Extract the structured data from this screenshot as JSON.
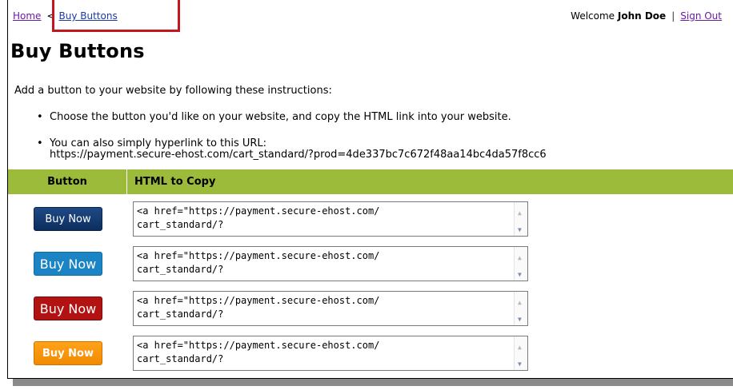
{
  "breadcrumb": {
    "home": "Home",
    "separator": "<",
    "current": "Buy Buttons"
  },
  "user": {
    "welcome": "Welcome",
    "name": "John Doe",
    "separator": "|",
    "sign_out": "Sign Out"
  },
  "page": {
    "title": "Buy Buttons",
    "intro": "Add a button to your website by following these instructions:",
    "bullets": [
      "Choose the button you'd like on your website, and copy the HTML link into your website.",
      "You can also simply hyperlink to this URL:"
    ],
    "url": "https://payment.secure-ehost.com/cart_standard/?prod=4de337bc7c672f48aa14bc4da57f8cc6"
  },
  "table": {
    "headers": [
      "Button",
      "HTML to Copy"
    ],
    "rows": [
      {
        "button_label": "Buy Now",
        "style": "navy",
        "code_line1": "<a href=\"https://payment.secure-ehost.com/",
        "code_line2": "cart_standard/?"
      },
      {
        "button_label": "Buy Now",
        "style": "blue",
        "code_line1": "<a href=\"https://payment.secure-ehost.com/",
        "code_line2": "cart_standard/?"
      },
      {
        "button_label": "Buy Now",
        "style": "red",
        "code_line1": "<a href=\"https://payment.secure-ehost.com/",
        "code_line2": "cart_standard/?"
      },
      {
        "button_label": "Buy Now",
        "style": "orange",
        "code_line1": "<a href=\"https://payment.secure-ehost.com/",
        "code_line2": "cart_standard/?"
      }
    ]
  },
  "colors": {
    "header_green": "#9cbb3a",
    "highlight_red": "#c4161c",
    "navy": "#0c2e5e",
    "blue": "#1b84c4",
    "red": "#b31212",
    "orange": "#f28a00"
  }
}
